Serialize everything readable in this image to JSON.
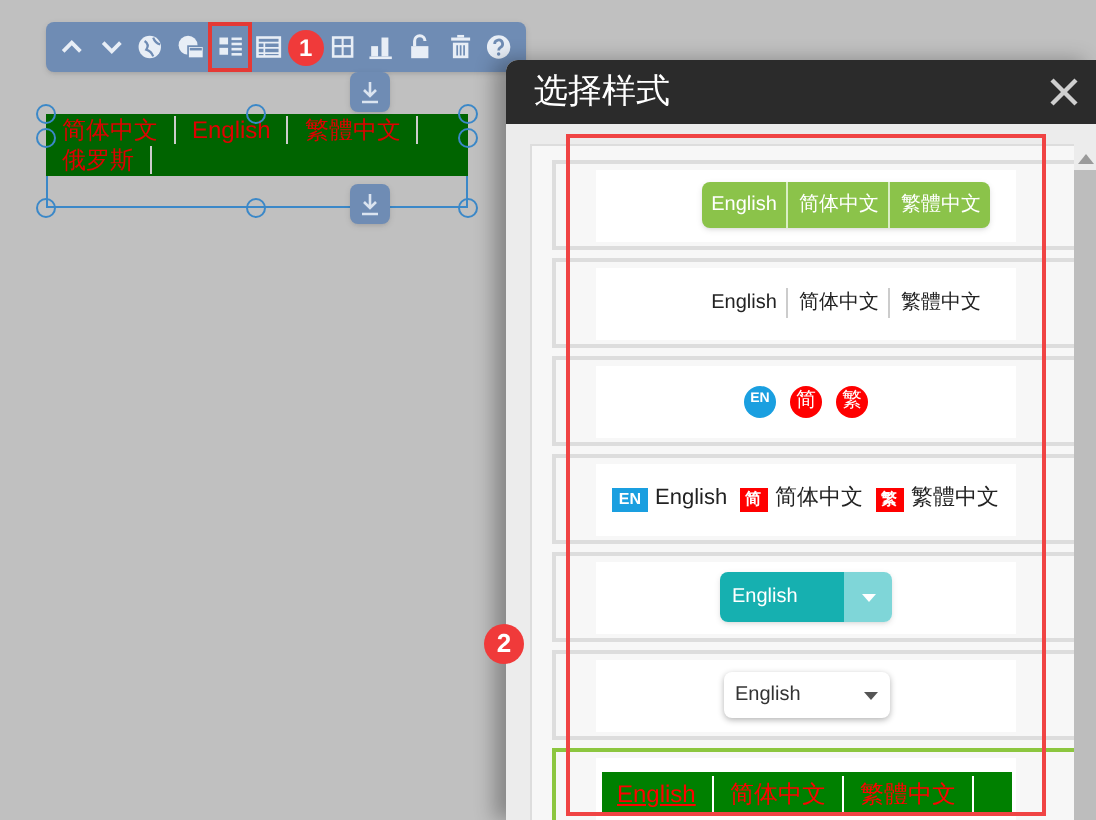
{
  "toolbar": {
    "badge": "1"
  },
  "widget": {
    "items": [
      "简体中文",
      "English",
      "繁體中文",
      "俄罗斯"
    ]
  },
  "dialog": {
    "title": "选择样式",
    "badge": "2",
    "styles": [
      {
        "kind": "pills",
        "selected": false,
        "items": [
          "English",
          "简体中文",
          "繁體中文"
        ]
      },
      {
        "kind": "plain",
        "selected": false,
        "items": [
          "English",
          "简体中文",
          "繁體中文"
        ]
      },
      {
        "kind": "circles",
        "selected": false,
        "items": [
          {
            "label": "EN",
            "color": "#1a9fe0"
          },
          {
            "label": "简",
            "color": "#ff0000"
          },
          {
            "label": "繁",
            "color": "#ff0000"
          }
        ]
      },
      {
        "kind": "flags",
        "selected": false,
        "items": [
          {
            "tag": "EN",
            "label": "English",
            "color": "#1a9fe0"
          },
          {
            "tag": "简",
            "label": "简体中文",
            "color": "#ff0000"
          },
          {
            "tag": "繁",
            "label": "繁體中文",
            "color": "#ff0000"
          }
        ]
      },
      {
        "kind": "dropdown",
        "selected": false,
        "value": "English"
      },
      {
        "kind": "select",
        "selected": false,
        "value": "English"
      },
      {
        "kind": "bar",
        "selected": true,
        "items": [
          "English",
          "简体中文",
          "繁體中文"
        ]
      }
    ]
  }
}
